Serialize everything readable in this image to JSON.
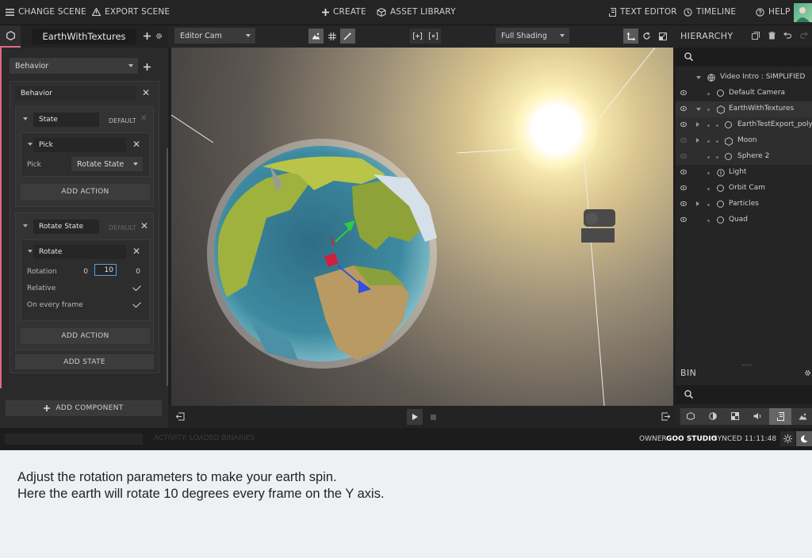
{
  "topbar": {
    "change_scene": "CHANGE SCENE",
    "export_scene": "EXPORT SCENE",
    "create": "CREATE",
    "asset_library": "ASSET LIBRARY",
    "text_editor": "TEXT EDITOR",
    "timeline": "TIMELINE",
    "help": "HELP"
  },
  "entity": {
    "name": "EarthWithTextures"
  },
  "camera_select": "Editor Cam",
  "shading_select": "Full Shading",
  "component": {
    "selected": "Behavior",
    "panel_title": "Behavior",
    "states": [
      {
        "name": "State",
        "default_label": "DEFAULT",
        "action": {
          "name": "Pick",
          "param_label": "Pick",
          "param_value": "Rotate State"
        },
        "add_action": "ADD ACTION"
      },
      {
        "name": "Rotate State",
        "default_label": "DEFAULT",
        "action": {
          "name": "Rotate",
          "rotation_label": "Rotation",
          "rotation": [
            "0",
            "10",
            "0"
          ],
          "relative_label": "Relative",
          "every_frame_label": "On every frame"
        },
        "add_action": "ADD ACTION"
      }
    ],
    "add_state": "ADD STATE",
    "add_component": "ADD COMPONENT"
  },
  "hierarchy": {
    "title": "HIERARCHY",
    "items": [
      {
        "label": "Video Intro : SIMPLIFIED",
        "level": 0
      },
      {
        "label": "Default Camera",
        "level": 1
      },
      {
        "label": "EarthWithTextures",
        "level": 1
      },
      {
        "label": "EarthTestExport_polySu",
        "level": 2
      },
      {
        "label": "Moon",
        "level": 2
      },
      {
        "label": "Sphere 2",
        "level": 2
      },
      {
        "label": "Light",
        "level": 1
      },
      {
        "label": "Orbit Cam",
        "level": 1
      },
      {
        "label": "Particles",
        "level": 1
      },
      {
        "label": "Quad",
        "level": 1
      }
    ]
  },
  "bin": {
    "title": "BIN"
  },
  "status": {
    "activity": "ACTIVITY: LOADED BINARIES",
    "owner_label": "OWNER",
    "owner": "GOO STUDIO",
    "synced": "SYNCED 11:11:48"
  },
  "colors": {
    "accent": "#e06a83",
    "panel": "#2a2a2a",
    "active_button": "#5a5a5a"
  },
  "caption": {
    "line1": "Adjust the rotation parameters to make your earth spin.",
    "line2": "Here the earth will rotate 10 degrees every frame on the Y axis."
  }
}
